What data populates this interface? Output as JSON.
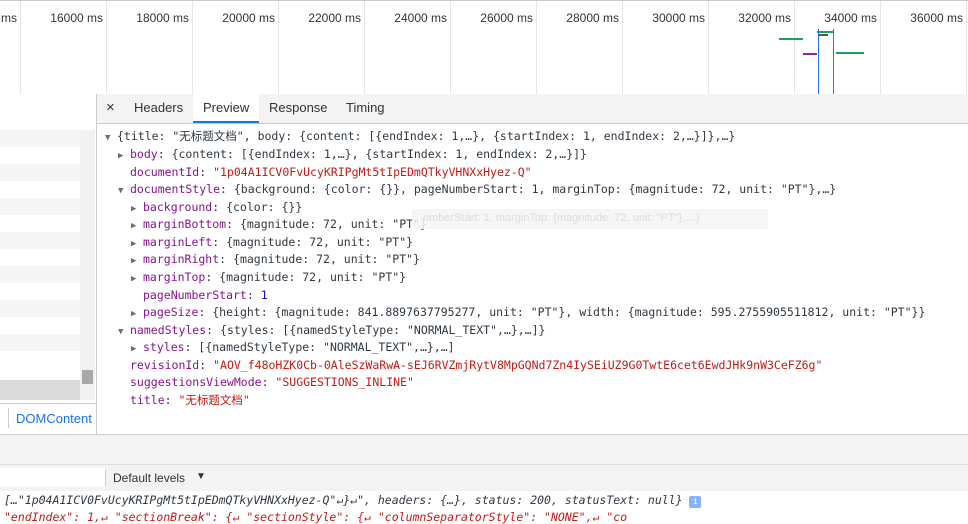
{
  "timeline": {
    "ticks": [
      "ms",
      "16000 ms",
      "18000 ms",
      "20000 ms",
      "22000 ms",
      "24000 ms",
      "26000 ms",
      "28000 ms",
      "30000 ms",
      "32000 ms",
      "34000 ms",
      "36000 ms"
    ]
  },
  "left_panel": {
    "domcontent_label": "DOMContent"
  },
  "tabs": {
    "close": "×",
    "headers": "Headers",
    "preview": "Preview",
    "response": "Response",
    "timing": "Timing"
  },
  "preview": {
    "root": "{title: \"无标题文档\", body: {content: [{endIndex: 1,…}, {startIndex: 1, endIndex: 2,…}]},…}",
    "body_key": "body",
    "body_val": "{content: [{endIndex: 1,…}, {startIndex: 1, endIndex: 2,…}]}",
    "documentId_key": "documentId",
    "documentId_val": "\"1p04A1ICV0FvUcyKRIPgMt5tIpEDmQTkyVHNXxHyez-Q\"",
    "documentStyle_key": "documentStyle",
    "documentStyle_val": "{background: {color: {}}, pageNumberStart: 1, marginTop: {magnitude: 72, unit: \"PT\"},…}",
    "background_key": "background",
    "background_val": "{color: {}}",
    "marginBottom_key": "marginBottom",
    "marginBottom_val": "{magnitude: 72, unit: \"PT\"}",
    "marginLeft_key": "marginLeft",
    "marginLeft_val": "{magnitude: 72, unit: \"PT\"}",
    "marginRight_key": "marginRight",
    "marginRight_val": "{magnitude: 72, unit: \"PT\"}",
    "marginTop_key": "marginTop",
    "marginTop_val": "{magnitude: 72, unit: \"PT\"}",
    "pageNumberStart_key": "pageNumberStart",
    "pageNumberStart_val": "1",
    "pageSize_key": "pageSize",
    "pageSize_val": "{height: {magnitude: 841.8897637795277, unit: \"PT\"}, width: {magnitude: 595.2755905511812, unit: \"PT\"}}",
    "namedStyles_key": "namedStyles",
    "namedStyles_val": "{styles: [{namedStyleType: \"NORMAL_TEXT\",…},…]}",
    "styles_key": "styles",
    "styles_val": "[{namedStyleType: \"NORMAL_TEXT\",…},…]",
    "revisionId_key": "revisionId",
    "revisionId_val": "\"AOV_f48oHZK0Cb-0AleSzWaRwA-sEJ6RVZmjRytV8MpGQNd7Zn4IySEiUZ9G0TwtE6cet6EwdJHk9nW3CeFZ6g\"",
    "suggestionsViewMode_key": "suggestionsViewMode",
    "suggestionsViewMode_val": "\"SUGGESTIONS_INLINE\"",
    "title_key": "title",
    "title_val": "\"无标题文档\"",
    "tooltip": "umberStart: 1, marginTop: {magnitude: 72, unit: \"PT\"},…}"
  },
  "console": {
    "levels_label": "Default levels",
    "line1": "[…\"1p04A1ICV0FvUcyKRIPgMt5tIpEDmQTkyVHNXxHyez-Q\"↵}↵\", headers: {…}, status: 200, statusText: null}",
    "line2": "\"endIndex\": 1,↵        \"sectionBreak\": {↵          \"sectionStyle\": {↵            \"columnSeparatorStyle\": \"NONE\",↵            \"co"
  },
  "colors": {
    "accent": "#1a73e8",
    "key": "#881391",
    "string": "#c41a16",
    "number": "#1c00cf",
    "waterfall_green": "#1aa260",
    "waterfall_blue": "#1a73e8",
    "waterfall_red": "#e53935",
    "waterfall_purple": "#8e24aa"
  }
}
